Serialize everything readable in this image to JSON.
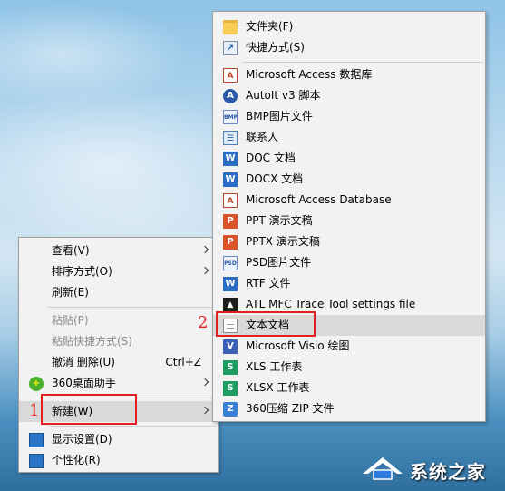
{
  "context_menu": {
    "items": [
      {
        "label": "查看(V)",
        "has_submenu": true
      },
      {
        "label": "排序方式(O)",
        "has_submenu": true
      },
      {
        "label": "刷新(E)"
      },
      {
        "label": "粘贴(P)",
        "disabled": true
      },
      {
        "label": "粘贴快捷方式(S)",
        "disabled": true
      },
      {
        "label": "撤消 删除(U)",
        "shortcut": "Ctrl+Z"
      },
      {
        "label": "360桌面助手",
        "icon": "360-icon",
        "has_submenu": true
      },
      {
        "label": "新建(W)",
        "has_submenu": true,
        "highlighted": true
      },
      {
        "label": "显示设置(D)",
        "icon": "display-settings-icon"
      },
      {
        "label": "个性化(R)",
        "icon": "personalize-icon"
      }
    ]
  },
  "new_submenu": {
    "items": [
      {
        "label": "文件夹(F)",
        "icon": "folder-icon"
      },
      {
        "label": "快捷方式(S)",
        "icon": "shortcut-icon"
      },
      {
        "label": "Microsoft Access 数据库",
        "icon": "access-icon"
      },
      {
        "label": "AutoIt v3 脚本",
        "icon": "autoit-icon"
      },
      {
        "label": "BMP图片文件",
        "icon": "bmp-icon"
      },
      {
        "label": "联系人",
        "icon": "contact-icon"
      },
      {
        "label": "DOC 文档",
        "icon": "word-icon"
      },
      {
        "label": "DOCX 文档",
        "icon": "word-icon"
      },
      {
        "label": "Microsoft Access Database",
        "icon": "access-icon"
      },
      {
        "label": "PPT 演示文稿",
        "icon": "powerpoint-icon"
      },
      {
        "label": "PPTX 演示文稿",
        "icon": "powerpoint-icon"
      },
      {
        "label": "PSD图片文件",
        "icon": "psd-icon"
      },
      {
        "label": "RTF 文件",
        "icon": "word-icon"
      },
      {
        "label": "ATL MFC Trace Tool settings file",
        "icon": "atl-icon"
      },
      {
        "label": "文本文档",
        "icon": "text-document-icon",
        "highlighted": true
      },
      {
        "label": "Microsoft Visio 绘图",
        "icon": "visio-icon"
      },
      {
        "label": "XLS 工作表",
        "icon": "excel-icon"
      },
      {
        "label": "XLSX 工作表",
        "icon": "excel-icon"
      },
      {
        "label": "360压缩 ZIP 文件",
        "icon": "zip-icon"
      }
    ]
  },
  "annotations": {
    "step1": "1",
    "step2": "2",
    "color": "#e02020"
  },
  "watermark": {
    "text": "系统之家"
  }
}
